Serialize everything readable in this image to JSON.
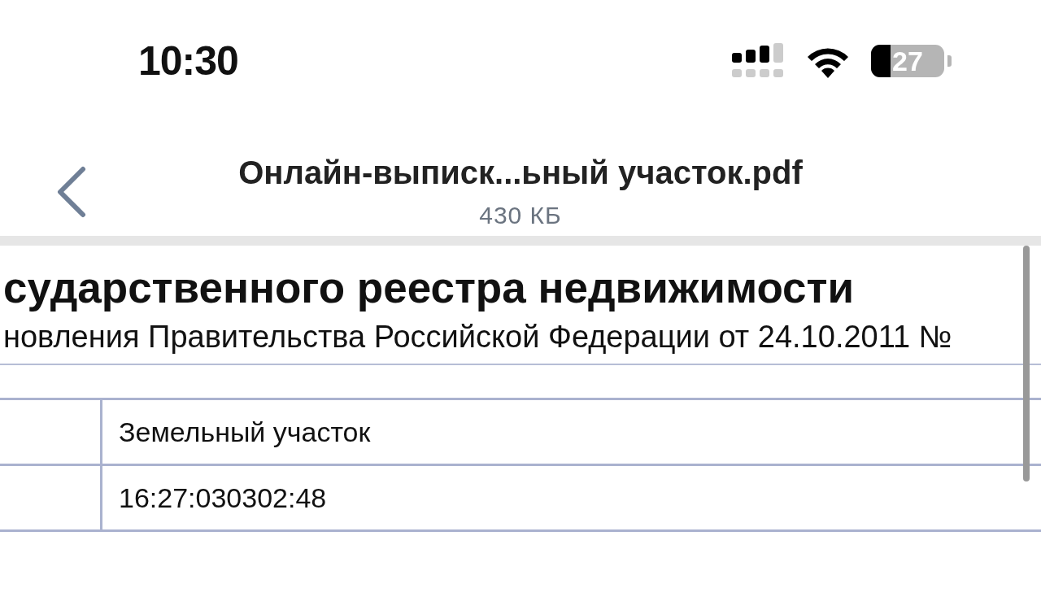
{
  "status_bar": {
    "time": "10:30",
    "battery": "27"
  },
  "header": {
    "title": "Онлайн-выписк...ьный участок.pdf",
    "size": "430 КБ"
  },
  "document": {
    "heading": "сударственного реестра недвижимости",
    "subheading": "новления Правительства Российской Федерации от 24.10.2011 №",
    "rows": [
      {
        "value": "Земельный участок"
      },
      {
        "value": "16:27:030302:48"
      }
    ]
  }
}
